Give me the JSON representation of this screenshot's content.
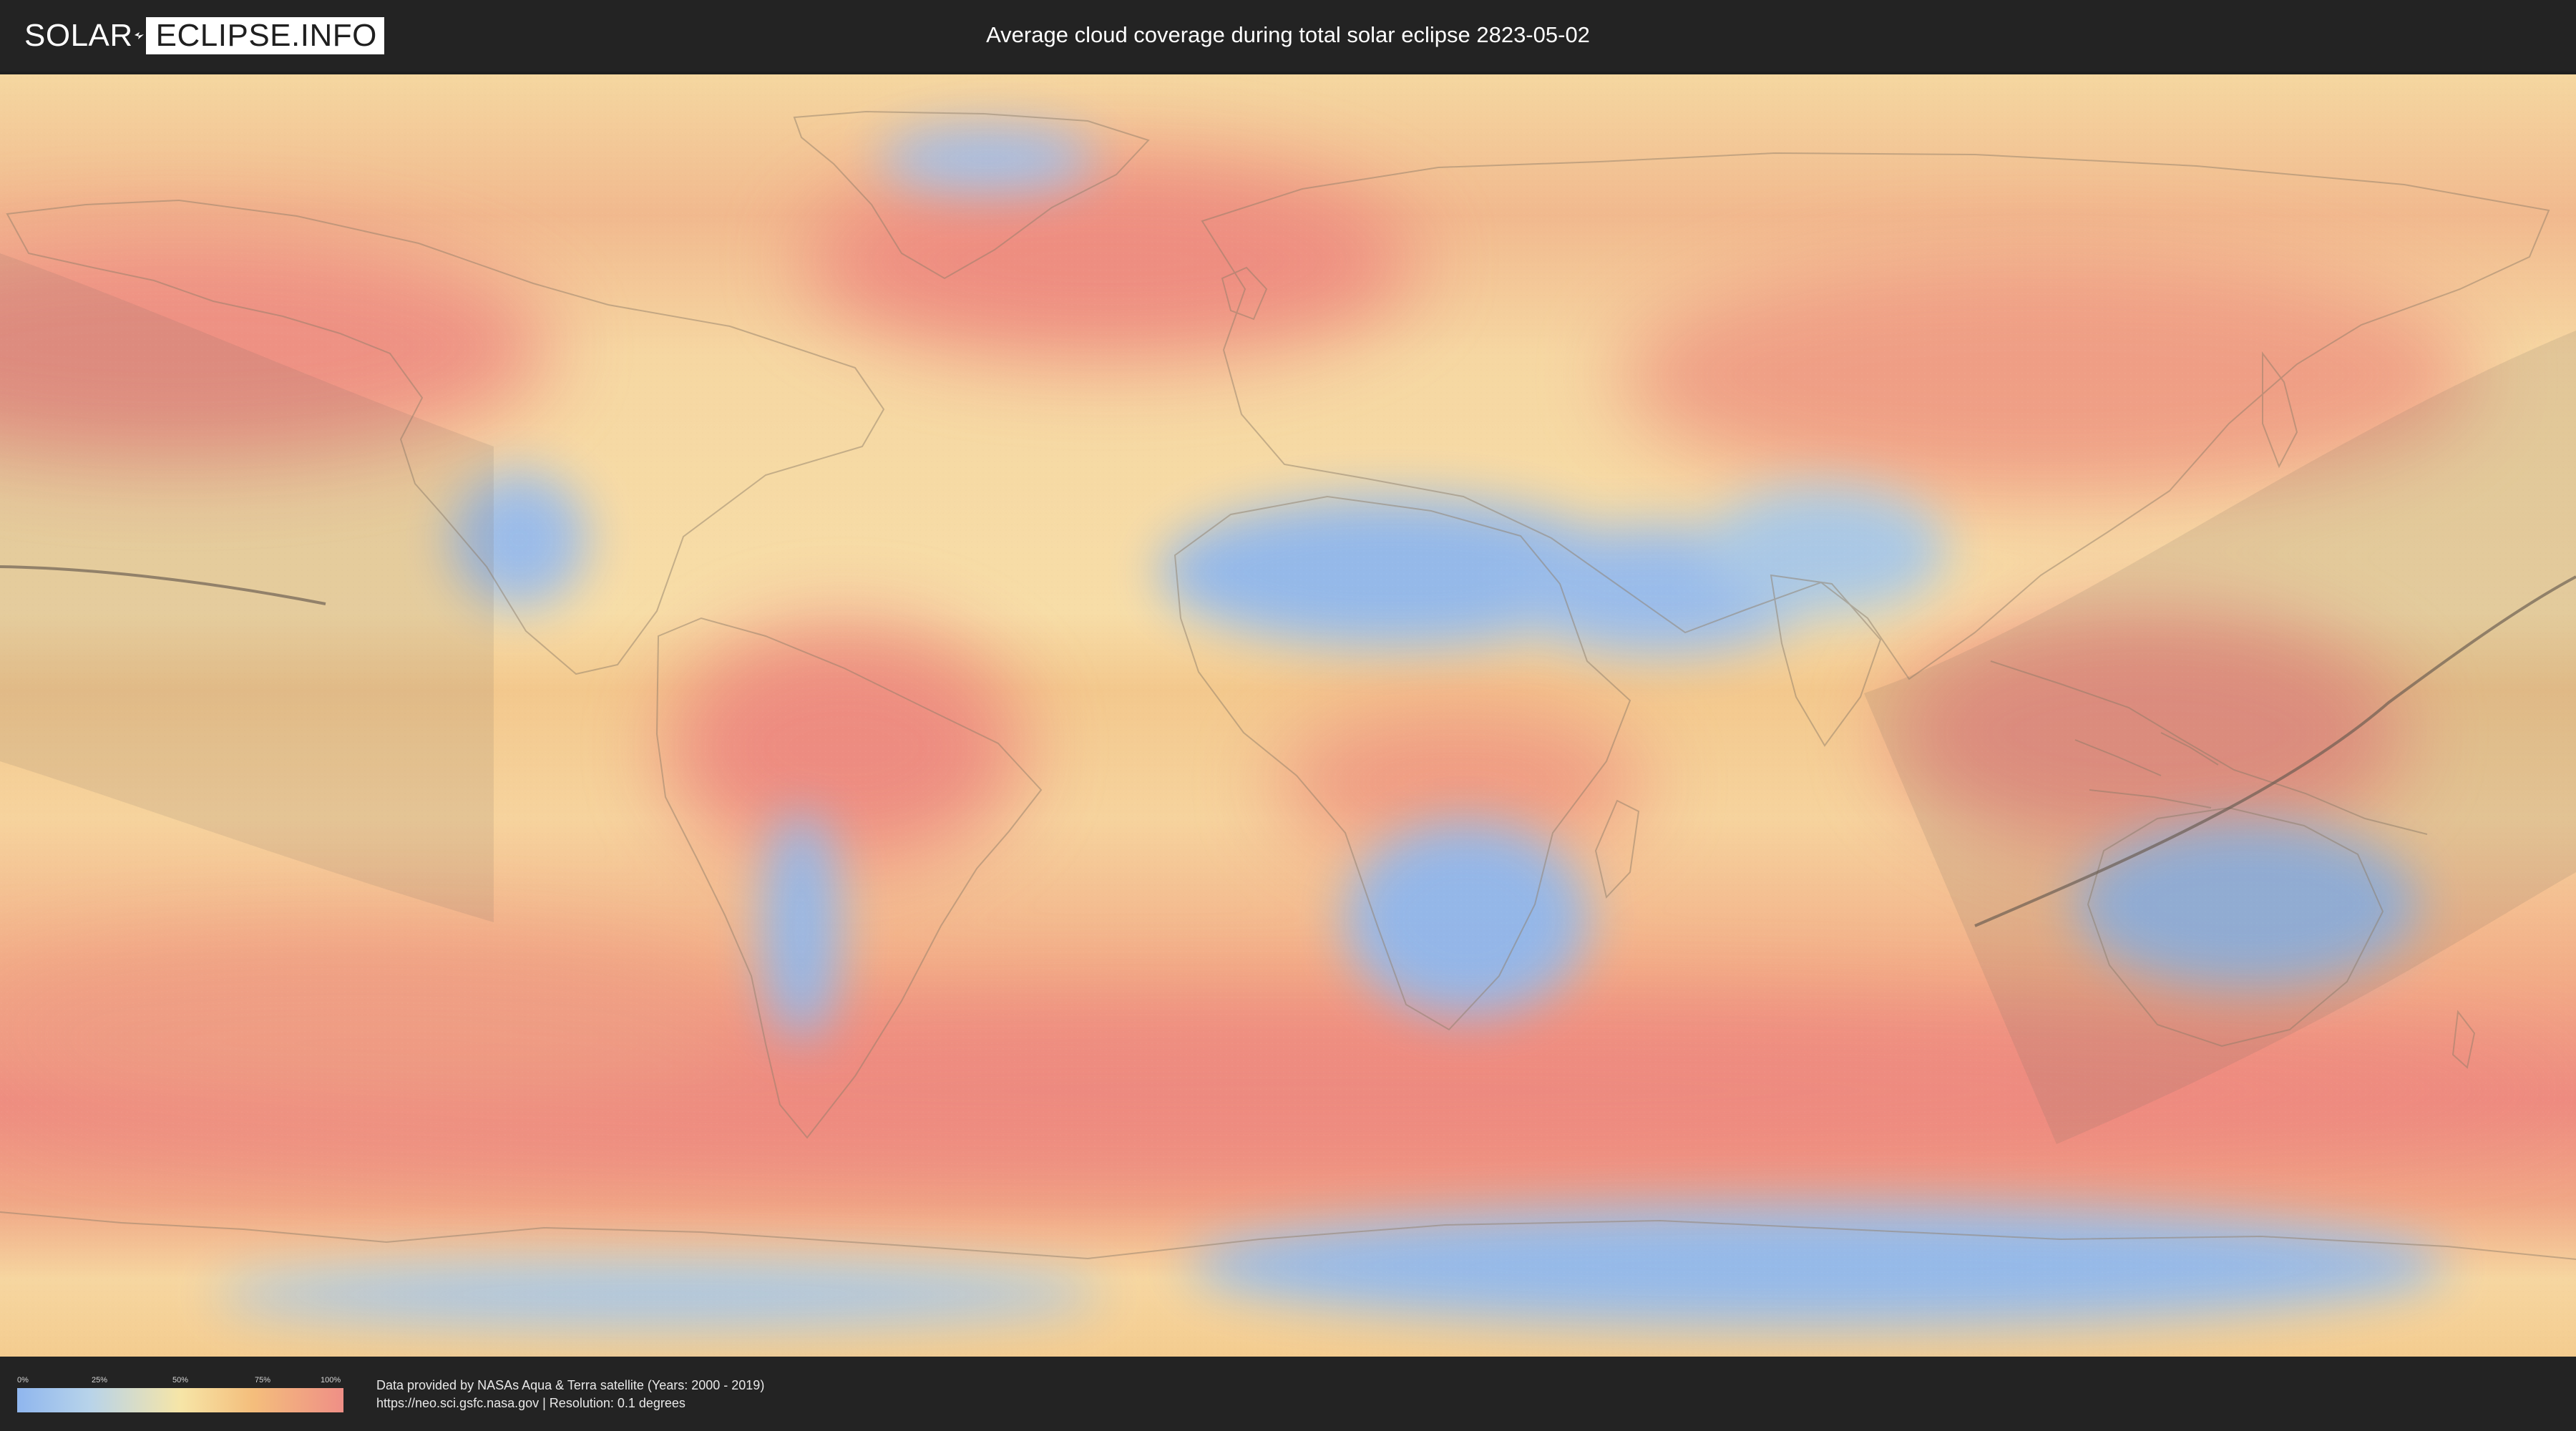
{
  "header": {
    "logo": {
      "left_text": "SOLAR",
      "right_text": "ECLIPSE.INFO"
    },
    "title": "Average cloud coverage during total solar eclipse 2823-05-02"
  },
  "map": {
    "colors": {
      "ocean_base": "#f3c98a",
      "high_cloud": "#ee8b80",
      "low_cloud": "#92b8ec",
      "medium_cloud": "#f6e3a4",
      "coastline": "#8e7d68",
      "eclipse_shadow": "#7b6d63",
      "central_line": "#66594f"
    }
  },
  "legend": {
    "ticks": [
      "0%",
      "25%",
      "50%",
      "75%",
      "100%"
    ],
    "gradient_colors": [
      "#8fb6ee",
      "#b7d3ea",
      "#f6e5a7",
      "#f4be7c",
      "#ef8f86"
    ]
  },
  "footer": {
    "line1": "Data provided by NASAs Aqua & Terra satellite (Years: 2000 - 2019)",
    "line2": "https://neo.sci.gsfc.nasa.gov | Resolution: 0.1 degrees"
  }
}
